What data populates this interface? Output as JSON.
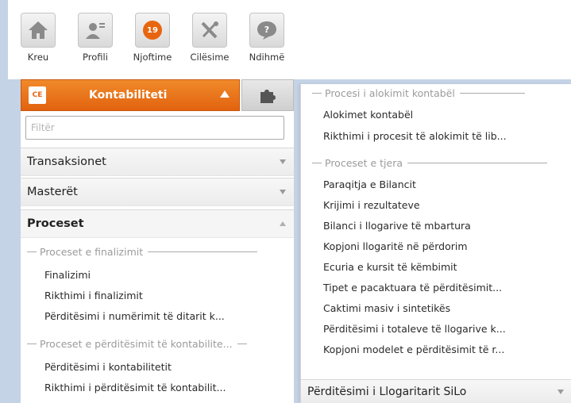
{
  "toolbar": {
    "home": "Kreu",
    "profile": "Profili",
    "notifications": "Njoftime",
    "notification_count": "19",
    "settings": "Cilësime",
    "help": "Ndihmë"
  },
  "module": {
    "label": "Kontabiliteti",
    "icon_text": "CE"
  },
  "filter": {
    "placeholder": "Filtër"
  },
  "sections": {
    "transactions": "Transaksionet",
    "masters": "Masterët",
    "processes": "Proceset"
  },
  "left_groups": [
    {
      "title": "Proceset e finalizimit",
      "items": [
        "Finalizimi",
        "Rikthimi i finalizimit",
        "Përditësimi i numërimit të ditarit k..."
      ]
    },
    {
      "title": "Proceset e përditësimit të kontabilite...",
      "items": [
        "Përditësimi i kontabilitetit",
        "Rikthimi i përditësimit të kontabilit..."
      ]
    }
  ],
  "right_groups": [
    {
      "title": "Procesi i alokimit kontabël",
      "items": [
        "Alokimet kontabël",
        "Rikthimi i procesit të alokimit të lib..."
      ]
    },
    {
      "title": "Proceset e tjera",
      "items": [
        "Paraqitja e Bilancit",
        "Krijimi i rezultateve",
        "Bilanci i llogarive të mbartura",
        "Kopjoni llogaritë në përdorim",
        "Ecuria e kursit të këmbimit",
        "Tipet e pacaktuara të përditësimit...",
        "Caktimi masiv i sintetikës",
        "Përditësimi i totaleve të llogarive k...",
        "Kopjoni modelet e përditësimit të r..."
      ]
    }
  ],
  "bottom_section": "Përditësimi i Llogaritarit SiLo",
  "colors": {
    "accent": "#e8650f",
    "background": "#c5d3e6"
  }
}
